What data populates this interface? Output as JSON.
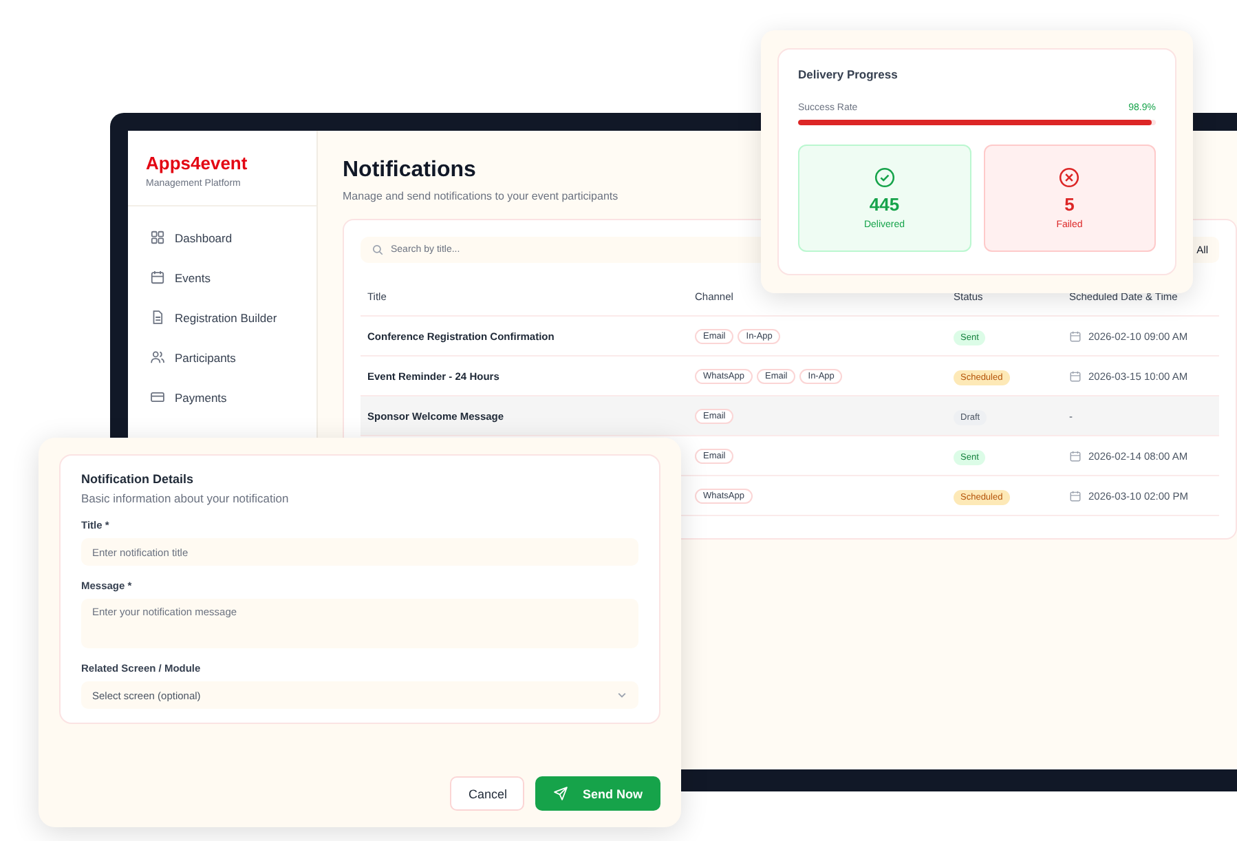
{
  "app": {
    "brand": "Apps4event",
    "tagline": "Management Platform",
    "nav": [
      {
        "label": "Dashboard",
        "selected": false
      },
      {
        "label": "Events",
        "selected": false
      },
      {
        "label": "Registration Builder",
        "selected": false
      },
      {
        "label": "Participants",
        "selected": false
      },
      {
        "label": "Payments",
        "selected": false
      }
    ],
    "page_title": "Notifications",
    "page_subtitle": "Manage and send notifications to your event participants",
    "search": {
      "placeholder": "Search by title..."
    },
    "filter": {
      "value": "All"
    },
    "table": {
      "columns": [
        "Title",
        "Channel",
        "Status",
        "Scheduled Date & Time"
      ],
      "rows": [
        {
          "title": "Conference Registration Confirmation",
          "channels": [
            "Email",
            "In-App"
          ],
          "status": {
            "text": "Sent",
            "kind": "sent"
          },
          "scheduled": "2026-02-10 09:00 AM",
          "date_icon": true,
          "highlighted": false
        },
        {
          "title": "Event Reminder - 24 Hours",
          "channels": [
            "WhatsApp",
            "Email",
            "In-App"
          ],
          "status": {
            "text": "Scheduled",
            "kind": "scheduled"
          },
          "scheduled": "2026-03-15 10:00 AM",
          "date_icon": true,
          "highlighted": false
        },
        {
          "title": "Sponsor Welcome Message",
          "channels": [
            "Email"
          ],
          "status": {
            "text": "Draft",
            "kind": "draft"
          },
          "scheduled": "-",
          "date_icon": false,
          "highlighted": true
        },
        {
          "channels": [
            "Email"
          ],
          "status": {
            "text": "Sent",
            "kind": "sent"
          },
          "scheduled": "2026-02-14 08:00 AM",
          "date_icon": true,
          "highlighted": false
        },
        {
          "channels": [
            "WhatsApp"
          ],
          "status": {
            "text": "Scheduled",
            "kind": "scheduled"
          },
          "scheduled": "2026-03-10 02:00 PM",
          "date_icon": true,
          "highlighted": false
        }
      ]
    }
  },
  "delivery": {
    "title": "Delivery Progress",
    "rate_label": "Success Rate",
    "rate": "98.9%",
    "level": 0.989,
    "stats": [
      {
        "kind": "success",
        "value": "445",
        "label": "Delivered"
      },
      {
        "kind": "failure",
        "value": "5",
        "label": "Failed"
      }
    ]
  },
  "form": {
    "title": "Notification Details",
    "subtitle": "Basic information about your notification",
    "fields": [
      {
        "kind": "text",
        "label": "Title *",
        "placeholder": "Enter notification title"
      },
      {
        "kind": "textarea",
        "label": "Message *",
        "placeholder": "Enter your notification message"
      },
      {
        "kind": "select",
        "label": "Related Screen / Module",
        "placeholder": "Select screen (optional)"
      }
    ],
    "buttons": [
      {
        "kind": "secondary",
        "label": "Cancel"
      },
      {
        "kind": "primary",
        "label": "Send Now"
      }
    ]
  }
}
